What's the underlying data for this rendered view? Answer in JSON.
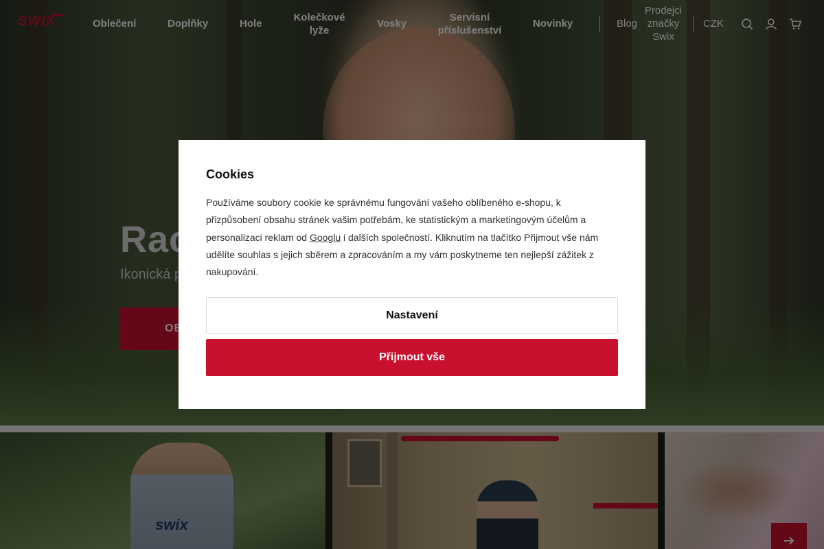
{
  "header": {
    "logo_text": "SWIX",
    "nav": [
      {
        "label": "Oblečení"
      },
      {
        "label": "Doplňky"
      },
      {
        "label": "Hole"
      },
      {
        "label": "Kolečkové\nlyže"
      },
      {
        "label": "Vosky"
      },
      {
        "label": "Servisní\npříslušenství"
      },
      {
        "label": "Novinky"
      }
    ],
    "blog_label": "Blog",
    "resellers_label": "Prodejci\nznačky\nSwix",
    "currency": "CZK",
    "icons": [
      "search-icon",
      "user-icon",
      "cart-icon"
    ]
  },
  "hero": {
    "title": "Rac",
    "subtitle": "Ikonická p",
    "cta_label": "OB"
  },
  "tiles": {
    "tile1_logo": "swix",
    "next_icon": "arrow-right-icon"
  },
  "cookie_modal": {
    "title": "Cookies",
    "text_before_link": "Používáme soubory cookie ke správnému fungování vašeho oblíbeného e-shopu, k přizpůsobení obsahu stránek vašim potřebám, ke statistickým a marketingovým účelům a personalizaci reklam od ",
    "link_text": "Googlu",
    "text_after_link": " i dalších společností. Kliknutím na tlačítko Přijmout vše nám udělíte souhlas s jejich sběrem a zpracováním a my vám poskytneme ten nejlepší zážitek z nakupování.",
    "settings_label": "Nastavení",
    "accept_label": "Přijmout vše"
  },
  "colors": {
    "brand": "#c8102e",
    "overlay": "rgba(0,0,0,0.5)"
  }
}
